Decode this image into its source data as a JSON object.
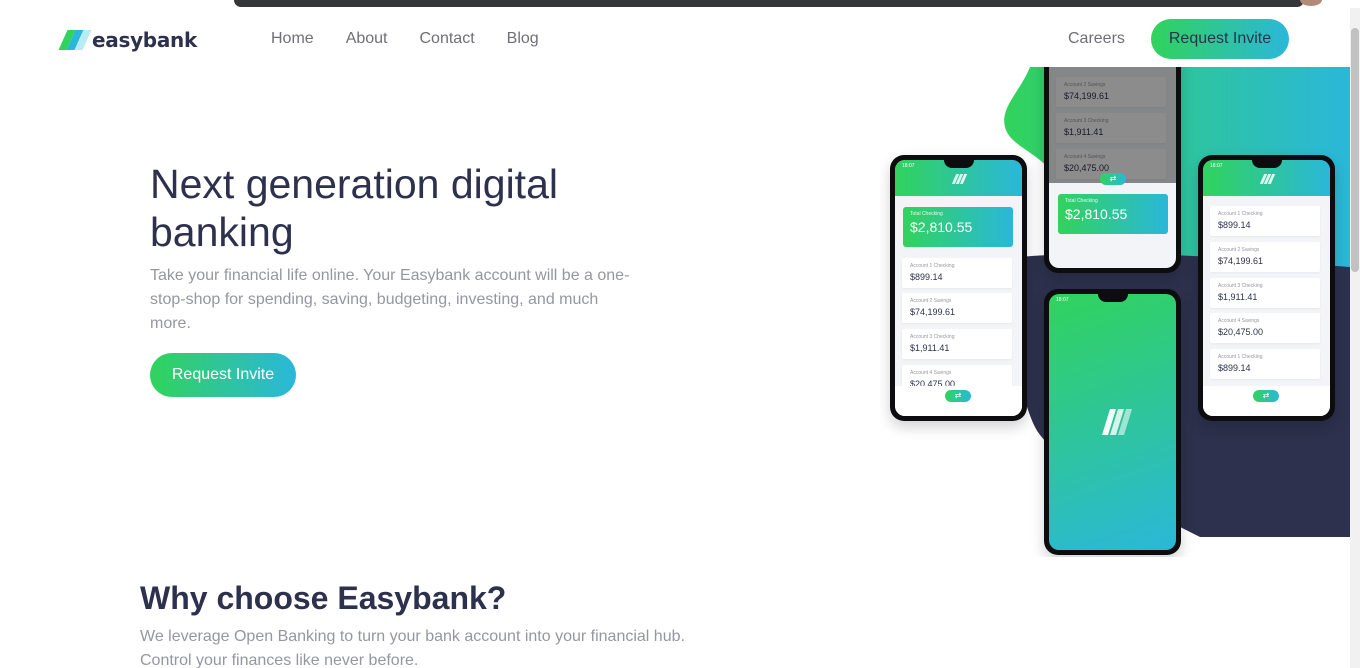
{
  "brand": {
    "name": "easybank",
    "accent_green": "#31d35c",
    "accent_cyan": "#2bb7da",
    "dark_blue": "#2d314d"
  },
  "nav": {
    "items": [
      "Home",
      "About",
      "Contact",
      "Blog"
    ],
    "careers": "Careers",
    "cta": "Request Invite"
  },
  "hero": {
    "title": "Next generation digital banking",
    "description": "Take your financial life online. Your Easybank account will be a one-stop-shop for spending, saving, budgeting, investing, and much more.",
    "cta": "Request Invite"
  },
  "why": {
    "title": "Why choose Easybank?",
    "description": "We leverage Open Banking to turn your bank account into your financial hub. Control your finances like never before."
  },
  "mockups": {
    "status_time": "18:07",
    "total_label": "Total Checking",
    "total_value": "$2,810.55",
    "accounts": [
      {
        "label": "Account 1 Checking",
        "value": "$899.14"
      },
      {
        "label": "Account 2 Savings",
        "value": "$74,199.61"
      },
      {
        "label": "Account 3 Checking",
        "value": "$1,911.41"
      },
      {
        "label": "Account 4 Savings",
        "value": "$20,475.00"
      },
      {
        "label": "Account 1 Checking",
        "value": "$899.14"
      }
    ],
    "pill_icon": "plus-minus-icon"
  }
}
